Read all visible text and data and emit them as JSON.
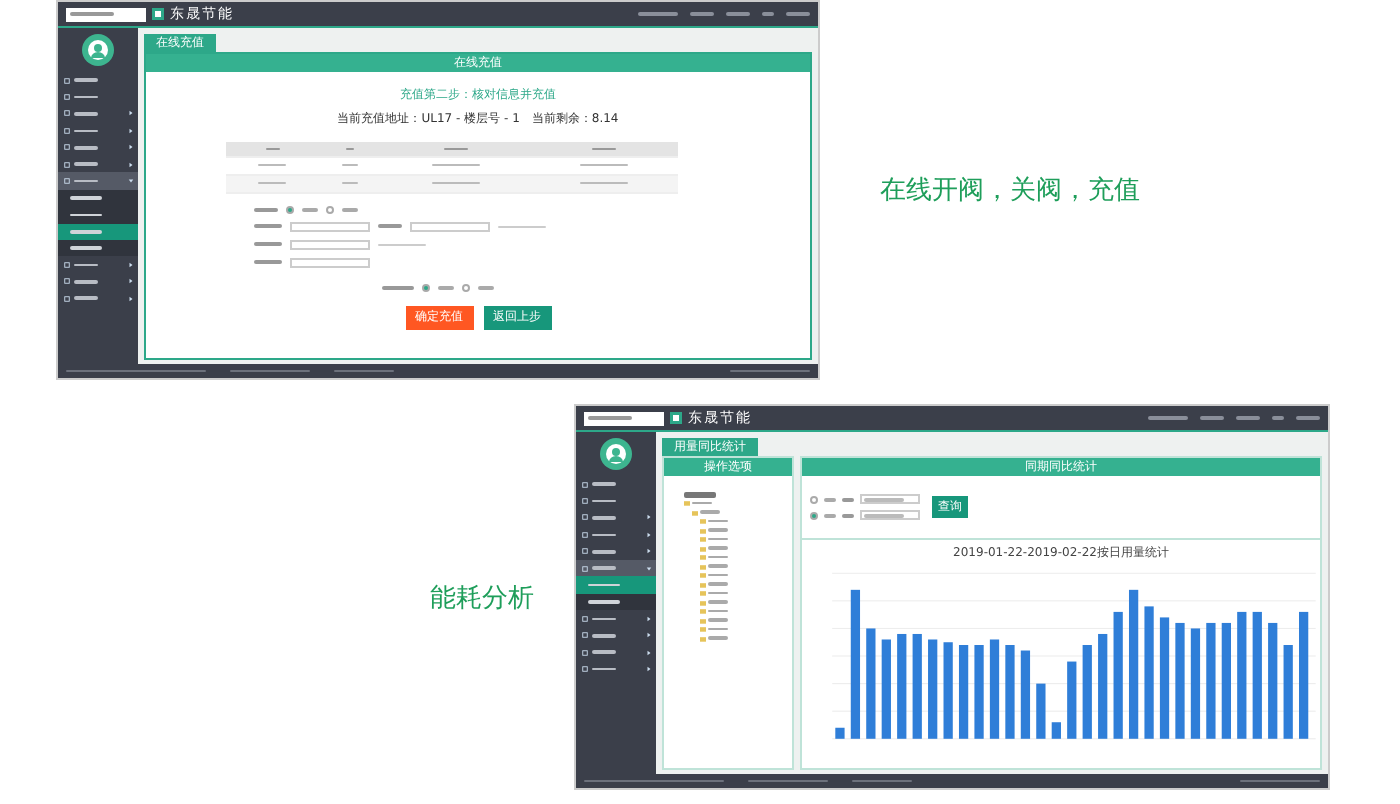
{
  "screen1": {
    "brand": "东晟节能",
    "menu": [
      {
        "selected": false
      },
      {
        "selected": false
      },
      {
        "selected": false
      },
      {
        "selected": false
      },
      {
        "selected": false
      },
      {
        "selected": false
      },
      {
        "selected": false,
        "expanded": true,
        "children": [
          {
            "selected": false
          },
          {
            "selected": false
          },
          {
            "selected": true
          },
          {
            "selected": false
          }
        ]
      },
      {
        "selected": false
      },
      {
        "selected": false
      },
      {
        "selected": false
      }
    ],
    "tab": "在线充值",
    "panel_title": "在线充值",
    "step": "充值第二步：核对信息并充值",
    "info": "当前充值地址：UL17 - 楼层号 - 1　当前剩余：8.14",
    "category_options": [
      {
        "selected": true
      },
      {
        "selected": false
      }
    ],
    "method_options": [
      {
        "selected": true
      },
      {
        "selected": false
      }
    ],
    "buttons": [
      {
        "label": "确定充值",
        "kind": "primary"
      },
      {
        "label": "返回上步",
        "kind": "secondary"
      }
    ]
  },
  "caption1": "在线开阀，关阀，充值",
  "caption2": "能耗分析",
  "screen2": {
    "brand": "东晟节能",
    "menu": [
      {
        "selected": false
      },
      {
        "selected": false
      },
      {
        "selected": false
      },
      {
        "selected": false
      },
      {
        "selected": false
      },
      {
        "selected": false,
        "expanded": true,
        "children": [
          {
            "selected": true
          },
          {
            "selected": false
          }
        ]
      },
      {
        "selected": false
      },
      {
        "selected": false
      },
      {
        "selected": false
      },
      {
        "selected": false
      }
    ],
    "tab": "用量同比统计",
    "left_title": "操作选项",
    "right_title": "同期同比统计",
    "modes": [
      {
        "selected": false
      },
      {
        "selected": true
      }
    ],
    "query": "查询",
    "chart_title": "2019-01-22-2019-02-22按日用量统计"
  }
}
